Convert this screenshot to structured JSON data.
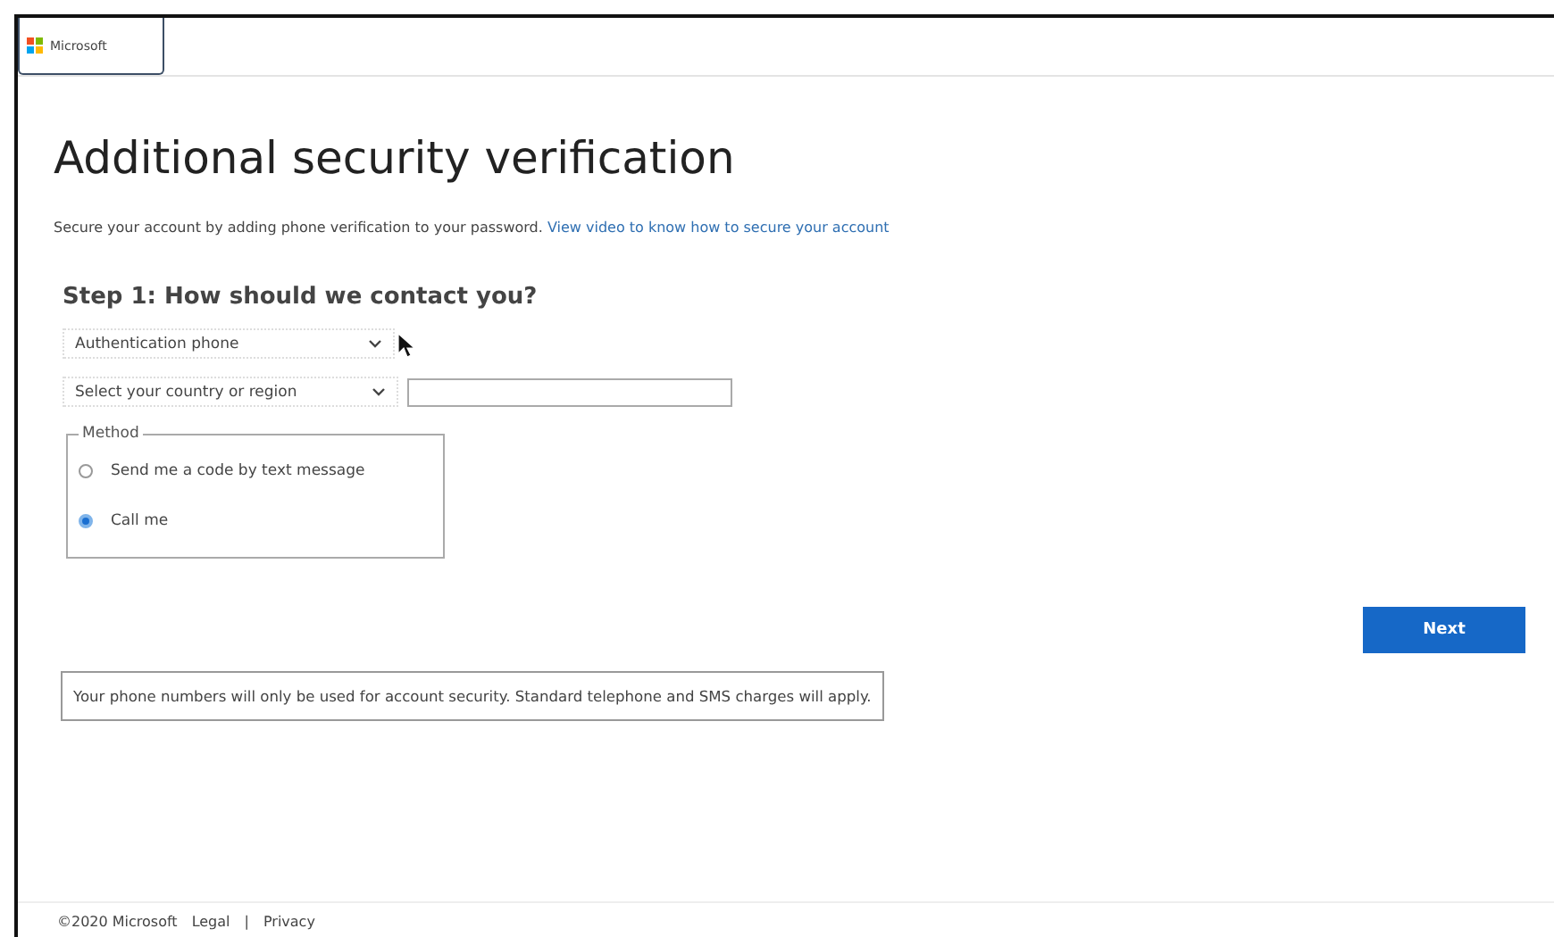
{
  "header": {
    "logo_text": "Microsoft"
  },
  "title": "Additional security verification",
  "intro": {
    "text": "Secure your account by adding phone verification to your password.",
    "link": "View video to know how to secure your account"
  },
  "step_heading": "Step 1: How should we contact you?",
  "contact_type": {
    "value": "Authentication phone"
  },
  "country": {
    "value": "Select your country or region"
  },
  "method": {
    "legend": "Method",
    "options": [
      {
        "label": "Send me a code by text message",
        "selected": false
      },
      {
        "label": "Call me",
        "selected": true
      }
    ]
  },
  "next_button": "Next",
  "notice": "Your phone numbers will only be used for account security. Standard telephone and SMS charges will apply.",
  "footer": {
    "copyright": "©2020 Microsoft",
    "links": [
      "Legal",
      "Privacy"
    ],
    "separator": "|"
  }
}
